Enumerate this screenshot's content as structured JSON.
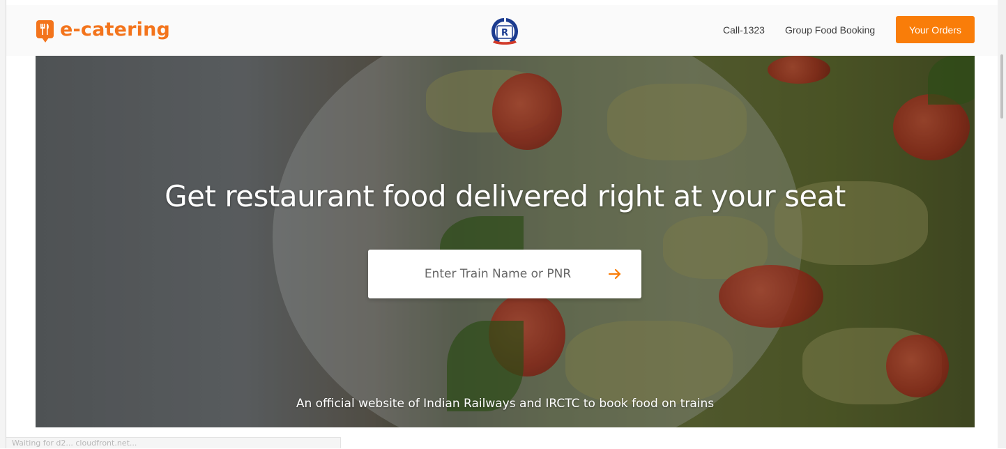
{
  "header": {
    "brand": "e-catering",
    "call_label": "Call-1323",
    "group_booking_label": "Group Food Booking",
    "orders_button": "Your Orders"
  },
  "hero": {
    "title": "Get restaurant food delivered right at your seat",
    "search_placeholder": "Enter Train Name or PNR",
    "footer_text": "An official website of Indian Railways and IRCTC to book food on trains"
  },
  "status_bar": {
    "text": "Waiting for d2... cloudfront.net..."
  },
  "icons": {
    "brand_logo": "fork-knife-icon",
    "irctc_logo": "irctc-logo-icon",
    "search_submit": "arrow-right-icon"
  },
  "colors": {
    "brand_orange": "#f3741c",
    "button_orange": "#f97d09",
    "arrow_orange": "#f97d09"
  }
}
